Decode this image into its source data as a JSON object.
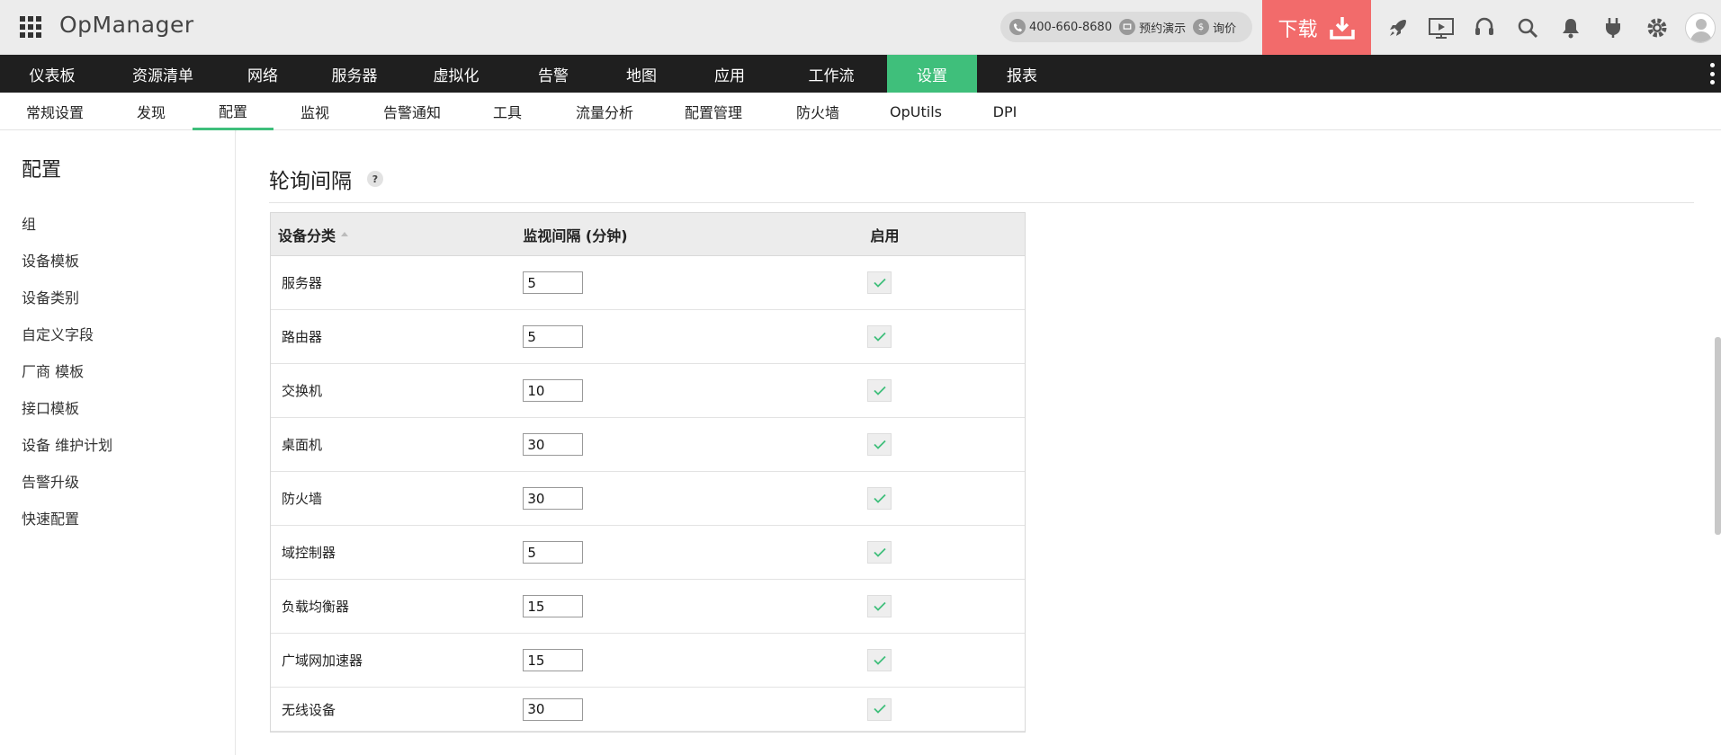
{
  "app": {
    "name": "OpManager"
  },
  "contact": {
    "phone": "400-660-8680",
    "demo": "预约演示",
    "quote": "询价",
    "quote_icon": "$"
  },
  "download_label": "下载",
  "header_icons": [
    "rocket-icon",
    "presentation-icon",
    "headset-icon",
    "search-icon",
    "bell-icon",
    "plug-icon",
    "gear-icon",
    "user-avatar"
  ],
  "main_nav": [
    {
      "label": "仪表板"
    },
    {
      "label": "资源清单"
    },
    {
      "label": "网络"
    },
    {
      "label": "服务器"
    },
    {
      "label": "虚拟化"
    },
    {
      "label": "告警"
    },
    {
      "label": "地图"
    },
    {
      "label": "应用"
    },
    {
      "label": "工作流"
    },
    {
      "label": "设置"
    },
    {
      "label": "报表"
    }
  ],
  "main_nav_active": "设置",
  "sub_nav": [
    {
      "label": "常规设置"
    },
    {
      "label": "发现"
    },
    {
      "label": "配置"
    },
    {
      "label": "监视"
    },
    {
      "label": "告警通知"
    },
    {
      "label": "工具"
    },
    {
      "label": "流量分析"
    },
    {
      "label": "配置管理"
    },
    {
      "label": "防火墙"
    },
    {
      "label": "OpUtils"
    },
    {
      "label": "DPI"
    }
  ],
  "sub_nav_active": "配置",
  "sidebar": {
    "title": "配置",
    "items": [
      {
        "label": "组"
      },
      {
        "label": "设备模板"
      },
      {
        "label": "设备类别"
      },
      {
        "label": "自定义字段"
      },
      {
        "label": "厂商 模板"
      },
      {
        "label": "接口模板"
      },
      {
        "label": "设备 维护计划"
      },
      {
        "label": "告警升级"
      },
      {
        "label": "快速配置"
      }
    ]
  },
  "page": {
    "title": "轮询间隔",
    "help_label": "?"
  },
  "table": {
    "headers": [
      "设备分类",
      "监视间隔 (分钟)",
      "启用"
    ],
    "rows": [
      {
        "category": "服务器",
        "interval": "5",
        "enabled": true
      },
      {
        "category": "路由器",
        "interval": "5",
        "enabled": true
      },
      {
        "category": "交换机",
        "interval": "10",
        "enabled": true
      },
      {
        "category": "桌面机",
        "interval": "30",
        "enabled": true
      },
      {
        "category": "防火墙",
        "interval": "30",
        "enabled": true
      },
      {
        "category": "域控制器",
        "interval": "5",
        "enabled": true
      },
      {
        "category": "负载均衡器",
        "interval": "15",
        "enabled": true
      },
      {
        "category": "广域网加速器",
        "interval": "15",
        "enabled": true
      },
      {
        "category": "无线设备",
        "interval": "30",
        "enabled": true
      }
    ]
  },
  "colors": {
    "accent": "#3fbf7b",
    "download": "#f26b6b",
    "nav_bg": "#1f1f1f",
    "check": "#3fbf7b"
  }
}
